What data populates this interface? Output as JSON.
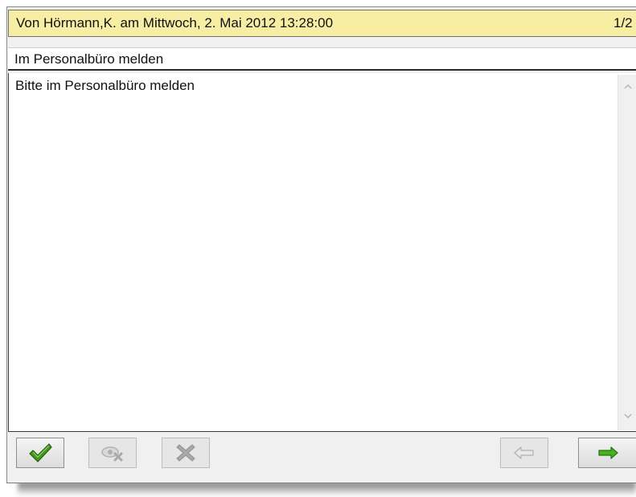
{
  "message": {
    "header": {
      "sender_line": "Von Hörmann,K. am Mittwoch, 2. Mai 2012 13:28:00",
      "page_indicator": "1/2"
    },
    "subject": "Im Personalbüro melden",
    "body": "Bitte im Personalbüro melden"
  },
  "toolbar": {
    "buttons": [
      {
        "icon": "checkmark-icon",
        "state": "enabled",
        "color": "#3f9a1e"
      },
      {
        "icon": "eye-hide-icon",
        "state": "disabled"
      },
      {
        "icon": "delete-x-icon",
        "state": "disabled"
      },
      {
        "icon": "arrow-left-icon",
        "state": "disabled"
      },
      {
        "icon": "arrow-right-icon",
        "state": "enabled",
        "color": "#43b41a"
      }
    ]
  },
  "colors": {
    "header_background": "#f7eda3",
    "window_background": "#f0f0f0"
  }
}
